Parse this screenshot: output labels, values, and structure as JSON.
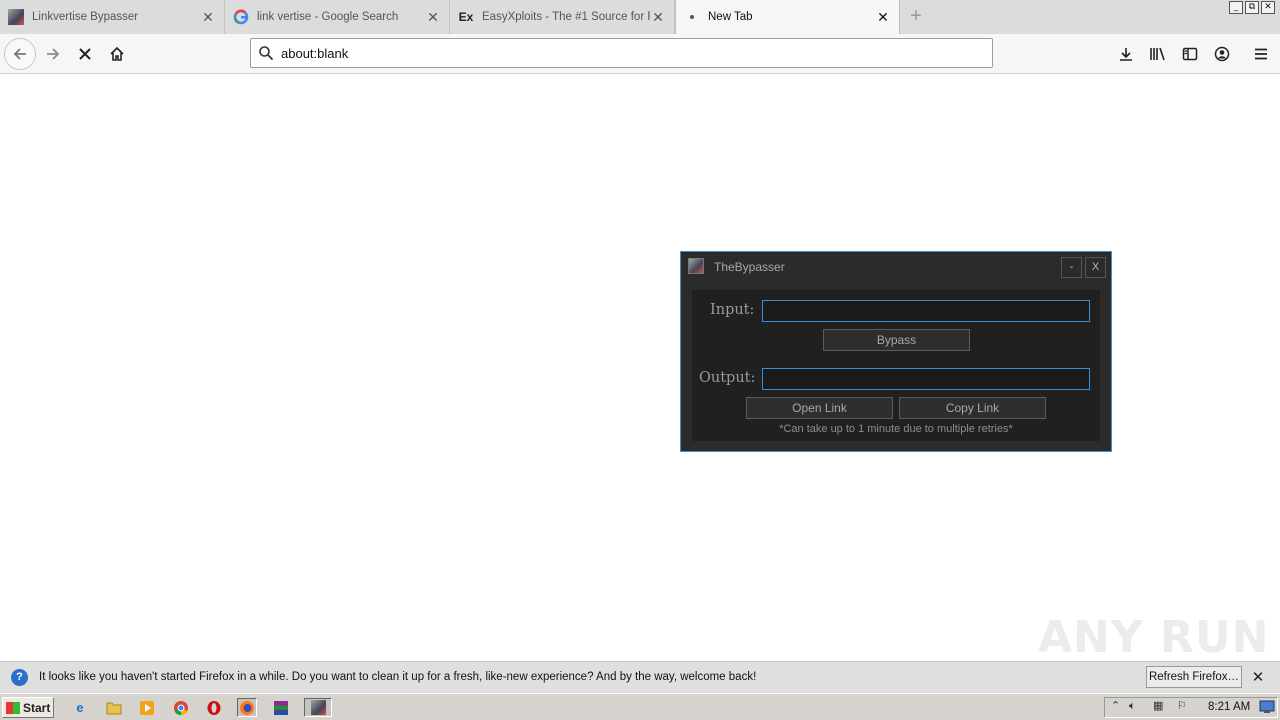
{
  "browser": {
    "tabs": [
      {
        "title": "Linkvertise Bypasser",
        "favicon": "bypasser-app-icon",
        "active": false
      },
      {
        "title": "link vertise - Google Search",
        "favicon": "google-icon",
        "active": false
      },
      {
        "title": "EasyXploits - The #1 Source for R",
        "favicon": "easyxploits-icon",
        "active": false
      },
      {
        "title": "New Tab",
        "favicon": "loading-dot-icon",
        "active": true
      }
    ],
    "new_tab_symbol": "+",
    "window_controls": {
      "minimize": "_",
      "maximize": "⧉",
      "close": "✕"
    },
    "url": "about:blank",
    "nav_icons": [
      "back-arrow-icon",
      "forward-arrow-icon",
      "stop-icon",
      "home-icon"
    ],
    "toolbar_icons": [
      "download-icon",
      "library-icon",
      "sidebar-icon",
      "account-icon",
      "menu-icon"
    ]
  },
  "app": {
    "title": "TheBypasser",
    "minimize_label": "-",
    "close_label": "X",
    "input_label": "Input:",
    "input_value": "",
    "bypass_label": "Bypass",
    "output_label": "Output:",
    "output_value": "",
    "open_link_label": "Open Link",
    "copy_link_label": "Copy Link",
    "note": "*Can take up to 1 minute due to multiple retries*",
    "accent_color": "#3c8fd4"
  },
  "notification": {
    "text": "It looks like you haven't started Firefox in a while. Do you want to clean it up for a fresh, like-new experience? And by the way, welcome back!",
    "button_label": "Refresh Firefox…",
    "close_symbol": "✕"
  },
  "taskbar": {
    "start_label": "Start",
    "apps": [
      "internet-explorer-icon",
      "folder-icon",
      "media-player-icon",
      "chrome-icon",
      "opera-icon",
      "firefox-icon",
      "winrar-icon",
      "bypasser-app-icon"
    ],
    "tray_icons": [
      "chevron-up-icon",
      "speaker-icon",
      "network-icon",
      "flag-icon"
    ],
    "clock": "8:21 AM"
  },
  "watermark": "ANY RUN"
}
